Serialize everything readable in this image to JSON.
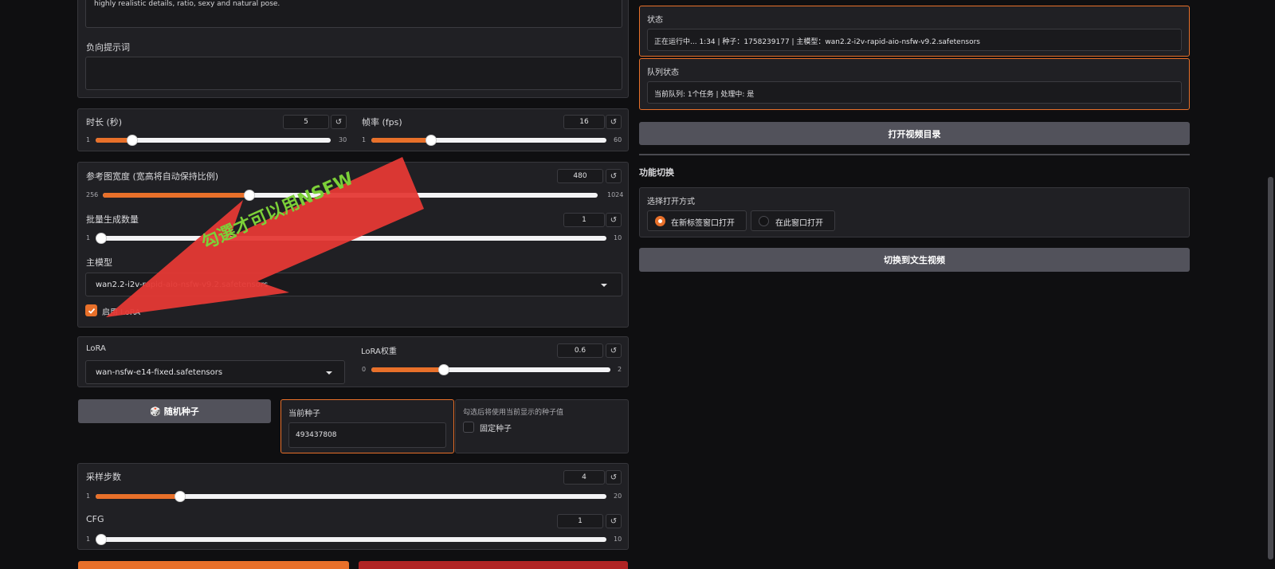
{
  "prompt_text": "highly realistic details, ratio, sexy and natural pose.",
  "negative_prompt": {
    "label": "负向提示词",
    "value": ""
  },
  "duration": {
    "label": "时长 (秒)",
    "value": "5",
    "min": "1",
    "max": "30",
    "level": 0.14
  },
  "fps": {
    "label": "帧率 (fps)",
    "value": "16",
    "min": "1",
    "max": "60",
    "level": 0.25
  },
  "reset_icon": "↺",
  "ref_width": {
    "label": "参考图宽度 (宽高将自动保持比例)",
    "value": "480",
    "min": "256",
    "max": "1024",
    "level": 0.29
  },
  "batch": {
    "label": "批量生成数量",
    "value": "1",
    "min": "1",
    "max": "10",
    "level": 0.0
  },
  "main_model": {
    "label": "主模型",
    "value": "wan2.2-i2v-rapid-aio-nsfw-v9.2.safetensors"
  },
  "enable_lora": {
    "label": "启用 LoRA",
    "checked": true
  },
  "lora": {
    "label": "LoRA",
    "value": "wan-nsfw-e14-fixed.safetensors"
  },
  "lora_weight": {
    "label": "LoRA权重",
    "value": "0.6",
    "min": "0",
    "max": "2",
    "level": 0.3
  },
  "random_seed_button": "🎲 随机种子",
  "current_seed": {
    "label": "当前种子",
    "value": "493437808"
  },
  "fixed_seed": {
    "hint": "勾选后将使用当前显示的种子值",
    "label": "固定种子",
    "checked": false
  },
  "steps": {
    "label": "采样步数",
    "value": "4",
    "min": "1",
    "max": "20",
    "level": 0.16
  },
  "cfg": {
    "label": "CFG",
    "value": "1",
    "min": "1",
    "max": "10",
    "level": 0.0
  },
  "status": {
    "label": "状态",
    "value": "正在运行中... 1:34 | 种子：1758239177 | 主模型：wan2.2-i2v-rapid-aio-nsfw-v9.2.safetensors"
  },
  "queue": {
    "label": "队列状态",
    "value": "当前队列: 1个任务 | 处理中: 是"
  },
  "open_video_dir_button": "打开视频目录",
  "feature_switch": {
    "title": "功能切换",
    "open_mode_label": "选择打开方式",
    "options": [
      "在新标签窗口打开",
      "在此窗口打开"
    ],
    "selected": 0
  },
  "switch_t2v_button": "切换到文生视频",
  "annotation": {
    "text": "勾選才可以用NSFW",
    "arrow_color": "#e53935",
    "text_color": "#7cd038"
  },
  "colors": {
    "accent": "#e8702a",
    "panel": "#202024",
    "background": "#0f0f11"
  }
}
